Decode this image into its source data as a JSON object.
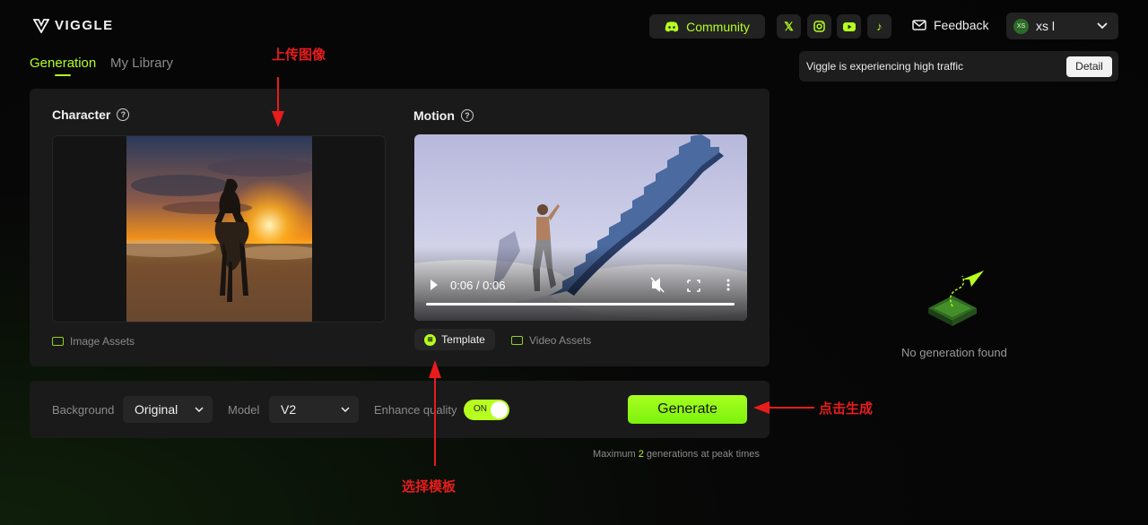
{
  "header": {
    "logo_text": "VIGGLE",
    "community_label": "Community",
    "social": [
      {
        "name": "x-icon",
        "glyph": "𝕏"
      },
      {
        "name": "instagram-icon",
        "glyph": "◎"
      },
      {
        "name": "youtube-icon",
        "glyph": "▶"
      },
      {
        "name": "tiktok-icon",
        "glyph": "♪"
      }
    ],
    "feedback_label": "Feedback",
    "user": {
      "avatar_initials": "XS",
      "name": "xs l"
    }
  },
  "tabs": [
    {
      "label": "Generation",
      "active": true
    },
    {
      "label": "My Library",
      "active": false
    }
  ],
  "banner": {
    "text": "Viggle is experiencing high traffic",
    "button": "Detail"
  },
  "character": {
    "title": "Character",
    "help": "?",
    "assets_link": "Image Assets"
  },
  "motion": {
    "title": "Motion",
    "help": "?",
    "video_time": "0:06 / 0:06",
    "template_label": "Template",
    "assets_link": "Video Assets"
  },
  "controls": {
    "background_label": "Background",
    "background_value": "Original",
    "model_label": "Model",
    "model_value": "V2",
    "enhance_label": "Enhance quality",
    "enhance_state": "ON",
    "generate_label": "Generate",
    "max_note_prefix": "Maximum ",
    "max_count": "2",
    "max_note_suffix": " generations at peak times"
  },
  "empty_state": {
    "text": "No generation found"
  },
  "annotations": {
    "upload_image": "上传图像",
    "select_template": "选择模板",
    "click_generate": "点击生成"
  },
  "colors": {
    "accent": "#b6ff1f",
    "annotation": "#e81c1c",
    "panel": "#1a1a1a"
  }
}
